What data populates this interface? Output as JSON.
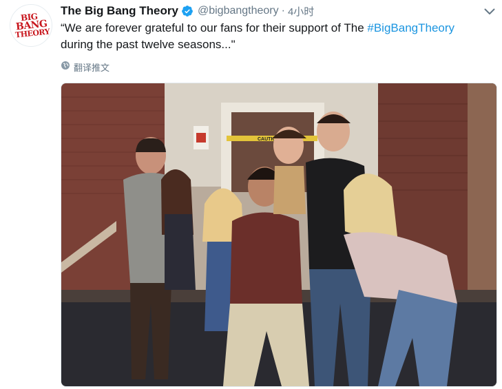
{
  "tweet": {
    "author_name": "The Big Bang Theory",
    "handle": "@bigbangtheory",
    "separator": "·",
    "time": "4小时",
    "text_before": "“We are forever grateful to our fans for their support of The ",
    "hashtag": "#BigBangTheory",
    "text_after": " during the past twelve seasons...\"",
    "translate_label": "翻译推文",
    "avatar_logo": {
      "line1": "BIG",
      "line2": "BANG",
      "line3": "THEORY"
    },
    "photo_signs": {
      "caution": "CAUTION"
    }
  },
  "icons": {
    "verified": "verified-badge-icon",
    "caret": "chevron-down-icon",
    "translate": "globe-icon"
  },
  "colors": {
    "link": "#1b95e0",
    "verified": "#1da1f2",
    "muted": "#657786",
    "logo_red": "#c8161d"
  }
}
